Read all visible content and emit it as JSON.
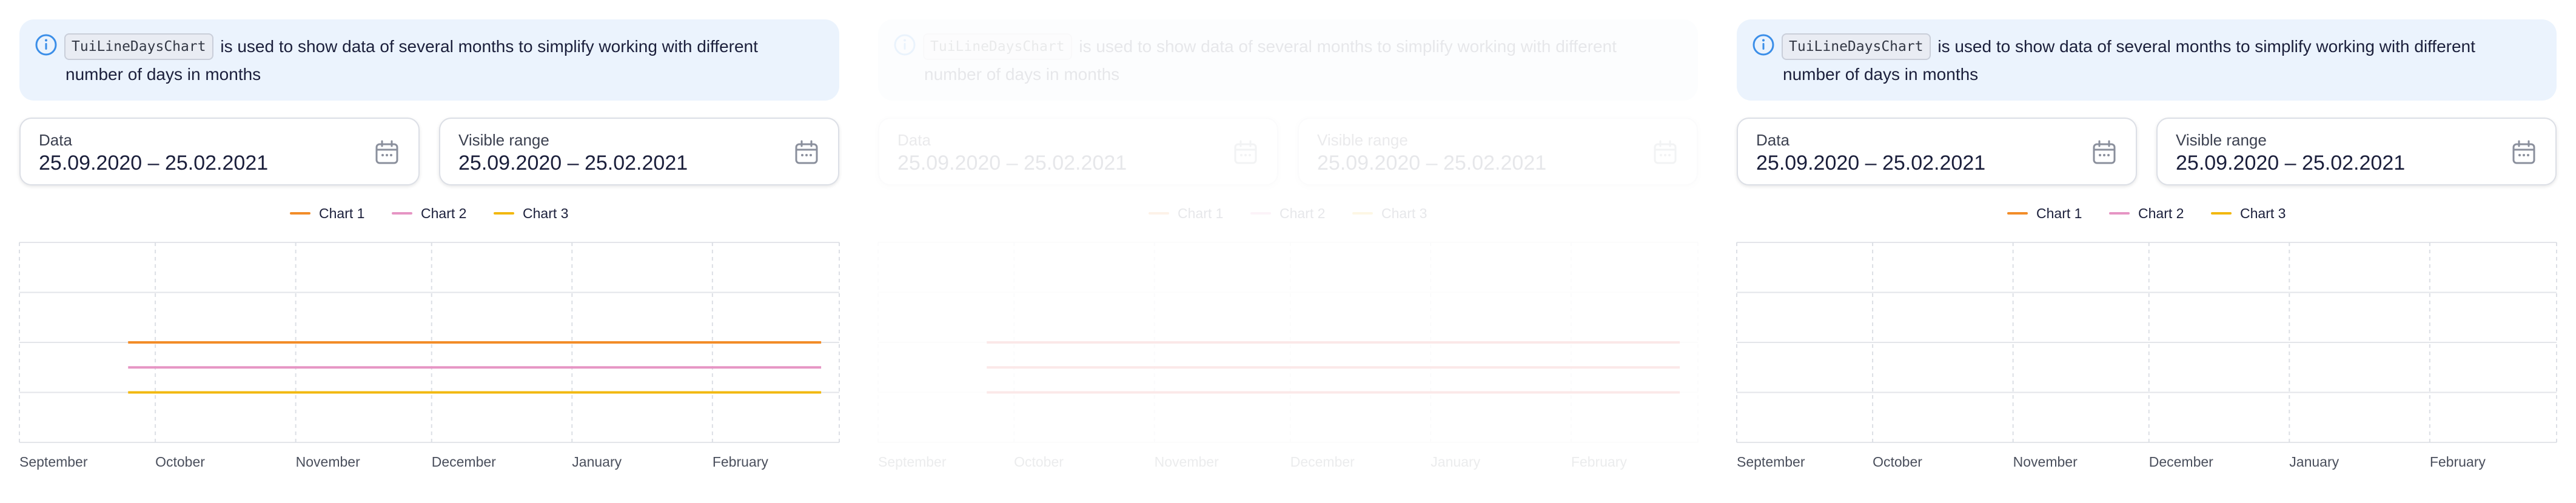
{
  "panels": [
    {
      "notice": {
        "code": "TuiLineDaysChart",
        "text_1": "is used to show data of several months to simplify working with different",
        "text_2": "number of days in months"
      },
      "data_field": {
        "label": "Data",
        "value": "25.09.2020 – 25.02.2021"
      },
      "range_field": {
        "label": "Visible range",
        "value": "25.09.2020 – 25.02.2021"
      },
      "legend": [
        {
          "label": "Chart 1",
          "color": "#f28c28"
        },
        {
          "label": "Chart 2",
          "color": "#e695c4"
        },
        {
          "label": "Chart 3",
          "color": "#f2b80f"
        }
      ]
    },
    {
      "notice": {
        "code": "TuiLineDaysChart",
        "text_1": "is used to show data of several months to simplify working with different",
        "text_2": "number of days in months"
      },
      "data_field": {
        "label": "Data",
        "value": "25.09.2020 – 25.02.2021"
      },
      "range_field": {
        "label": "Visible range",
        "value": "25.09.2020 – 25.02.2021"
      },
      "legend": [
        {
          "label": "Chart 1",
          "color": "#f28c28"
        },
        {
          "label": "Chart 2",
          "color": "#e695c4"
        },
        {
          "label": "Chart 3",
          "color": "#f2b80f"
        }
      ]
    },
    {
      "notice": {
        "code": "TuiLineDaysChart",
        "text_1": "is used to show data of several months to simplify working with different",
        "text_2": "number of days in months"
      },
      "data_field": {
        "label": "Data",
        "value": "25.09.2020 – 25.02.2021"
      },
      "range_field": {
        "label": "Visible range",
        "value": "25.09.2020 – 25.02.2021"
      },
      "legend": [
        {
          "label": "Chart 1",
          "color": "#f28c28"
        },
        {
          "label": "Chart 2",
          "color": "#e695c4"
        },
        {
          "label": "Chart 3",
          "color": "#f2b80f"
        }
      ]
    }
  ],
  "chart_data": [
    {
      "type": "line",
      "x_tick_labels": [
        "September",
        "October",
        "November",
        "December",
        "January",
        "February"
      ],
      "x_range": [
        "2020-09-01",
        "2021-02-28"
      ],
      "y_range": [
        0,
        4
      ],
      "grid": true,
      "legend_position": "top-center",
      "series": [
        {
          "name": "Chart 1",
          "color": "#f28c28",
          "x": [
            "2020-09-25",
            "2021-02-25"
          ],
          "y": [
            2,
            2
          ]
        },
        {
          "name": "Chart 2",
          "color": "#e695c4",
          "x": [
            "2020-09-25",
            "2021-02-25"
          ],
          "y": [
            1.5,
            1.5
          ]
        },
        {
          "name": "Chart 3",
          "color": "#f2b80f",
          "x": [
            "2020-09-25",
            "2021-02-25"
          ],
          "y": [
            1,
            1
          ]
        }
      ]
    },
    {
      "type": "line",
      "x_tick_labels": [
        "September",
        "October",
        "November",
        "December",
        "January",
        "February"
      ],
      "x_range": [
        "2020-09-01",
        "2021-02-28"
      ],
      "y_range": [
        0,
        4
      ],
      "grid": true,
      "legend_position": "top-center",
      "series": [
        {
          "name": "Chart 1",
          "color": "#e0262b",
          "x": [
            "2020-09-25",
            "2021-02-25"
          ],
          "y": [
            2,
            2
          ]
        },
        {
          "name": "Chart 2",
          "color": "#e0262b",
          "x": [
            "2020-09-25",
            "2021-02-25"
          ],
          "y": [
            1.5,
            1.5
          ]
        },
        {
          "name": "Chart 3",
          "color": "#e0262b",
          "x": [
            "2020-09-25",
            "2021-02-25"
          ],
          "y": [
            1,
            1
          ]
        }
      ]
    },
    {
      "type": "line",
      "x_tick_labels": [
        "September",
        "October",
        "November",
        "December",
        "January",
        "February"
      ],
      "x_range": [
        "2020-09-01",
        "2021-02-28"
      ],
      "y_range": [
        0,
        4
      ],
      "grid": true,
      "legend_position": "top-center",
      "series": []
    }
  ]
}
